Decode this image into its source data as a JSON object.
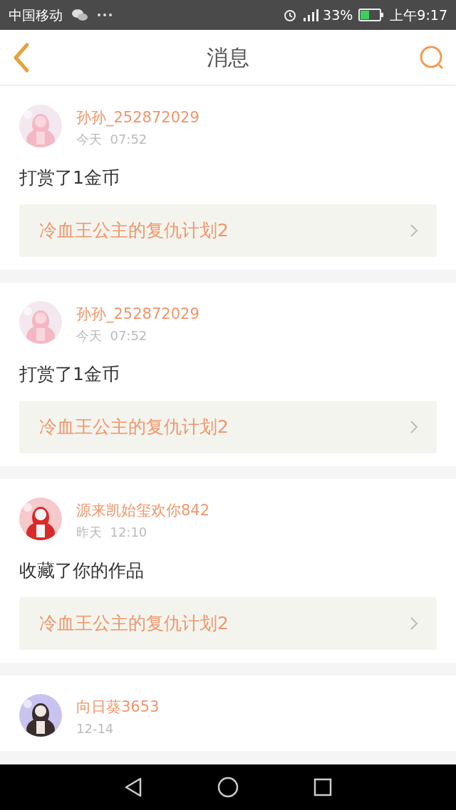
{
  "status_bar": {
    "carrier": "中国移动",
    "battery": "33%",
    "time": "上午9:17"
  },
  "header": {
    "title": "消息"
  },
  "messages": [
    {
      "user": "孙孙_252872029",
      "time": "今天  07:52",
      "action": "打赏了1金币",
      "book": "冷血王公主的复仇计划2"
    },
    {
      "user": "孙孙_252872029",
      "time": "今天  07:52",
      "action": "打赏了1金币",
      "book": "冷血王公主的复仇计划2"
    },
    {
      "user": "源来凯始玺欢你842",
      "time": "昨天  12:10",
      "action": "收藏了你的作品",
      "book": "冷血王公主的复仇计划2"
    },
    {
      "user": "向日葵3653",
      "time": "12-14"
    }
  ]
}
